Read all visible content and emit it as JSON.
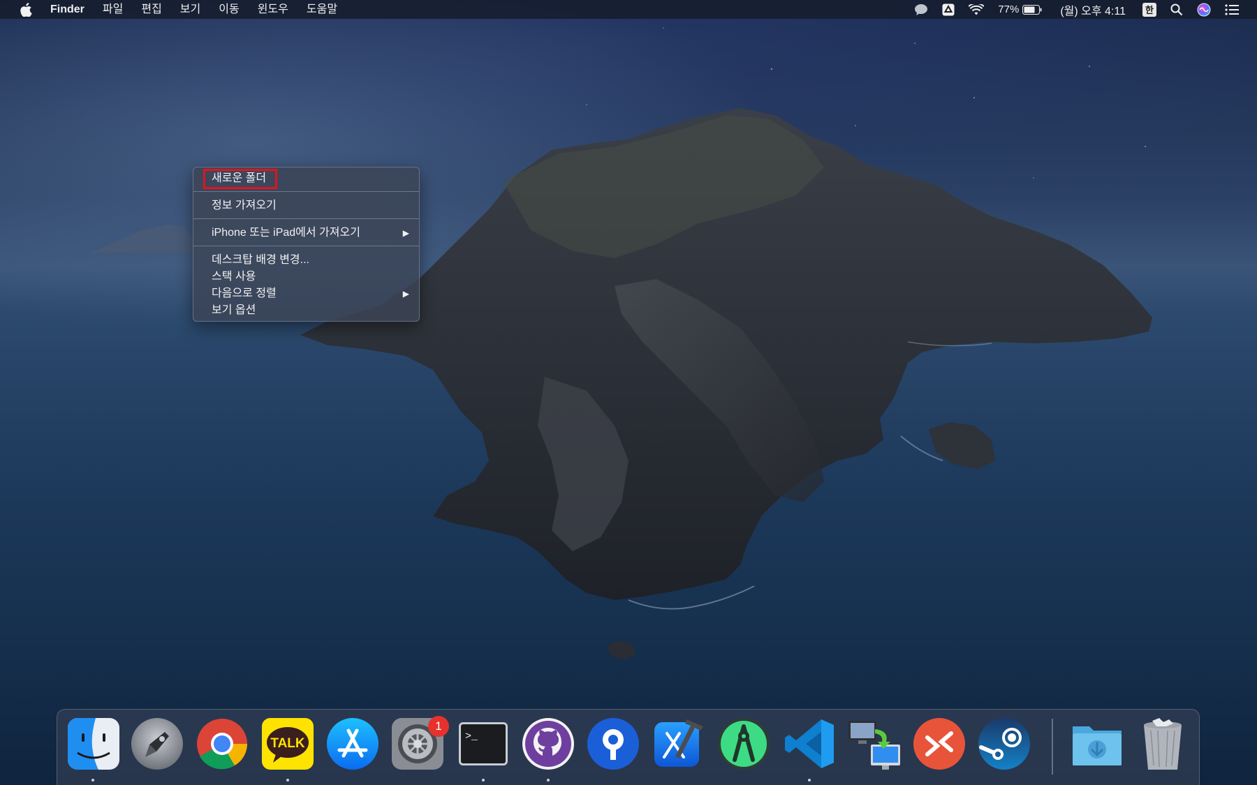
{
  "menubar": {
    "app_name": "Finder",
    "items": [
      "파일",
      "편집",
      "보기",
      "이동",
      "윈도우",
      "도움말"
    ],
    "battery": "77%",
    "clock": "(월) 오후 4:11",
    "input_method": "한"
  },
  "context_menu": {
    "new_folder": "새로운 폴더",
    "get_info": "정보 가져오기",
    "import_from_device": "iPhone 또는 iPad에서 가져오기",
    "change_background": "데스크탑 배경 변경...",
    "use_stacks": "스택 사용",
    "sort_by": "다음으로 정렬",
    "view_options": "보기 옵션",
    "submenu_arrow": "▶",
    "highlighted": "새로운 폴더",
    "highlight_color": "#e0141e"
  },
  "dock": {
    "apps": [
      {
        "name": "finder-icon",
        "running": true
      },
      {
        "name": "launchpad-icon",
        "running": false
      },
      {
        "name": "chrome-icon",
        "running": false
      },
      {
        "name": "kakaotalk-icon",
        "running": true
      },
      {
        "name": "app-store-icon",
        "running": false
      },
      {
        "name": "system-preferences-icon",
        "running": false
      },
      {
        "name": "terminal-icon",
        "running": true
      },
      {
        "name": "github-desktop-icon",
        "running": true
      },
      {
        "name": "sourcetree-icon",
        "running": false
      },
      {
        "name": "xcode-icon",
        "running": false
      },
      {
        "name": "android-studio-icon",
        "running": false
      },
      {
        "name": "vscode-icon",
        "running": true
      },
      {
        "name": "migration-assistant-icon",
        "running": false
      },
      {
        "name": "remote-desktop-icon",
        "running": false
      },
      {
        "name": "steam-icon",
        "running": false
      },
      {
        "name": "downloads-folder-icon",
        "running": false
      },
      {
        "name": "trash-icon",
        "running": false
      }
    ],
    "kakaotalk_label": "TALK",
    "terminal_prompt": ">_",
    "system_preferences_badge": "1"
  }
}
